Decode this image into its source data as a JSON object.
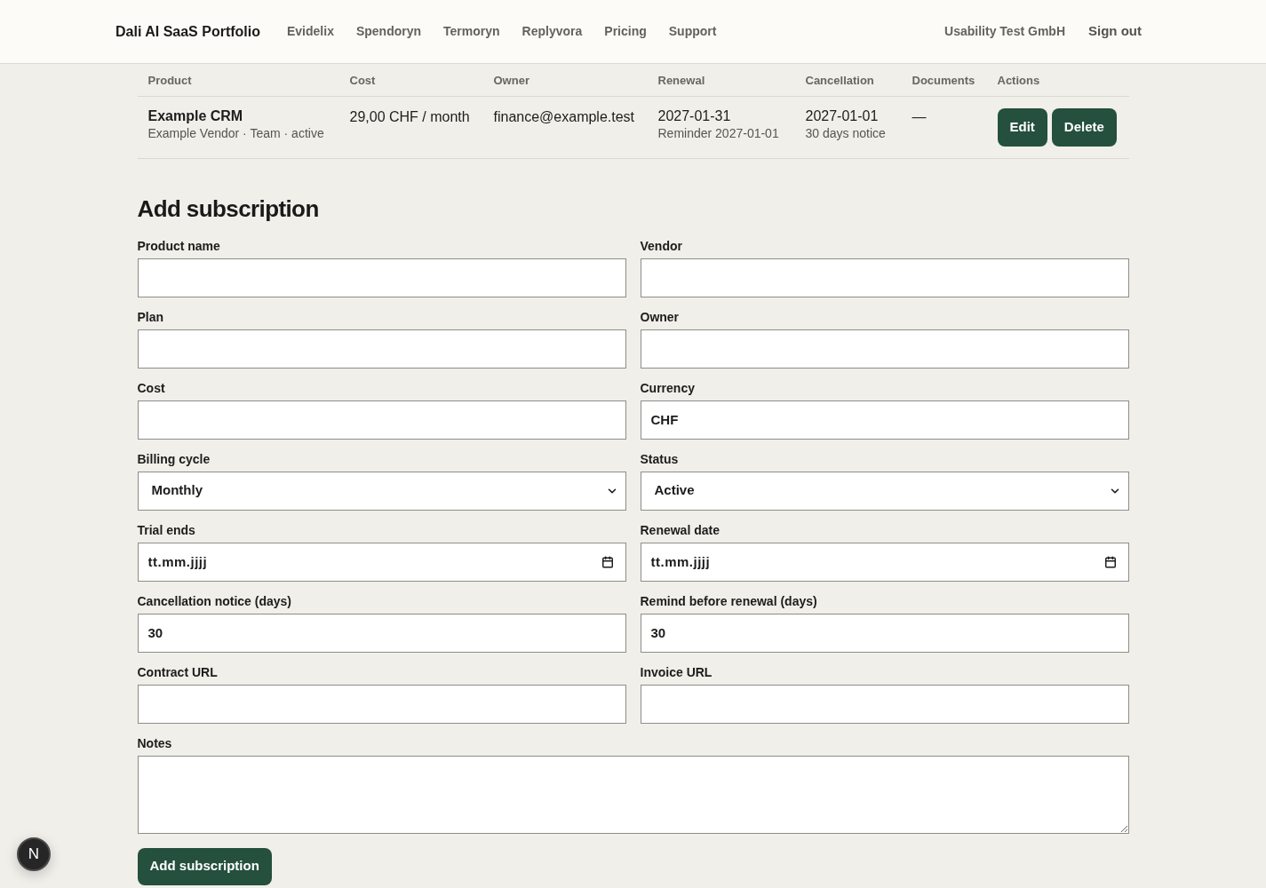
{
  "header": {
    "brand": "Dali AI SaaS Portfolio",
    "nav": [
      {
        "label": "Evidelix"
      },
      {
        "label": "Spendoryn"
      },
      {
        "label": "Termoryn"
      },
      {
        "label": "Replyvora"
      },
      {
        "label": "Pricing"
      },
      {
        "label": "Support"
      }
    ],
    "account": "Usability Test GmbH",
    "sign_out": "Sign out"
  },
  "table": {
    "columns": [
      "Product",
      "Cost",
      "Owner",
      "Renewal",
      "Cancellation",
      "Documents",
      "Actions"
    ],
    "rows": [
      {
        "product": {
          "name": "Example CRM",
          "details": "Example Vendor · Team · active"
        },
        "cost": "29,00 CHF / month",
        "owner": "finance@example.test",
        "renewal": {
          "date": "2027-01-31",
          "note": "Reminder 2027-01-01"
        },
        "cancellation": {
          "date": "2027-01-01",
          "note": "30 days notice"
        },
        "documents": "—",
        "actions": [
          {
            "label": "Edit"
          },
          {
            "label": "Delete"
          }
        ]
      }
    ]
  },
  "form": {
    "title": "Add subscription",
    "fields": [
      {
        "label": "Product name",
        "kind": "text"
      },
      {
        "label": "Vendor",
        "kind": "text"
      },
      {
        "label": "Plan",
        "kind": "text"
      },
      {
        "label": "Owner",
        "kind": "text"
      },
      {
        "label": "Cost",
        "kind": "text"
      },
      {
        "label": "Currency",
        "kind": "text",
        "value": "CHF"
      },
      {
        "label": "Billing cycle",
        "kind": "select",
        "value": "Monthly"
      },
      {
        "label": "Status",
        "kind": "select",
        "value": "Active"
      },
      {
        "label": "Trial ends",
        "kind": "date",
        "placeholder": "tt.mm.jjjj"
      },
      {
        "label": "Renewal date",
        "kind": "date",
        "placeholder": "tt.mm.jjjj"
      },
      {
        "label": "Cancellation notice (days)",
        "kind": "text",
        "value": "30"
      },
      {
        "label": "Remind before renewal (days)",
        "kind": "text",
        "value": "30"
      },
      {
        "label": "Contract URL",
        "kind": "text"
      },
      {
        "label": "Invoice URL",
        "kind": "text"
      },
      {
        "label": "Notes",
        "kind": "textarea"
      }
    ],
    "submit": "Add subscription"
  },
  "dev_badge": {
    "label": "N"
  }
}
